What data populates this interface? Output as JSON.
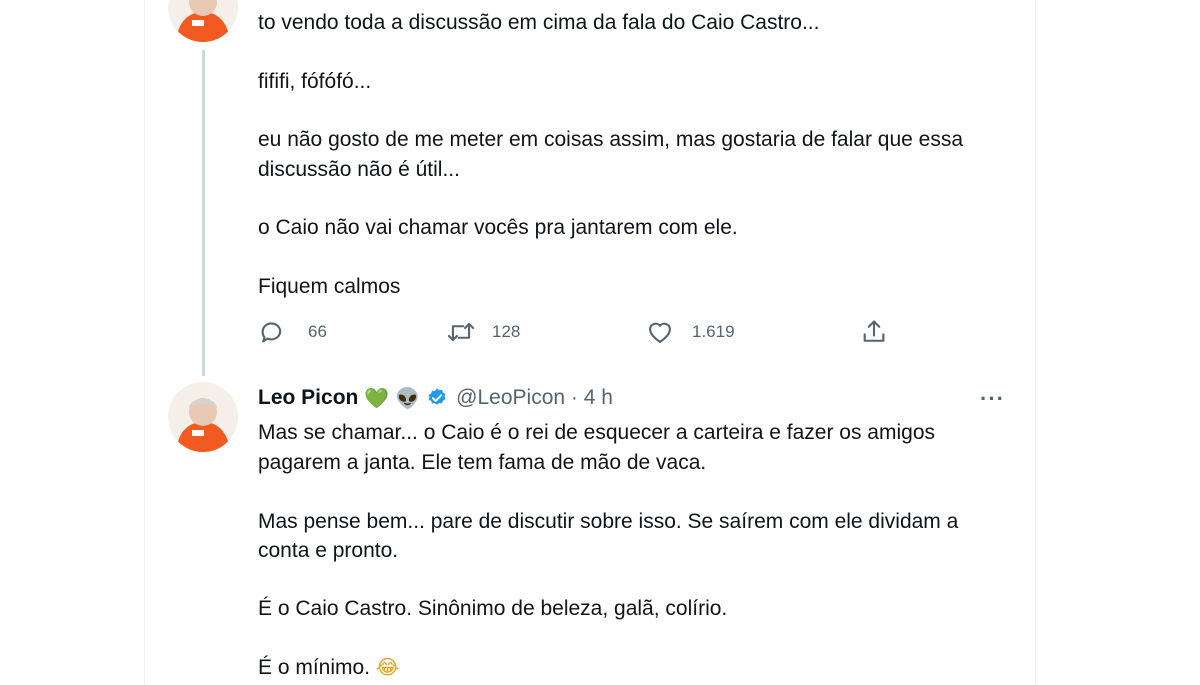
{
  "tweet1": {
    "paragraphs": [
      "to vendo toda a discussão em cima da fala do Caio Castro...",
      "fififi, fófófó...",
      "eu não gosto de me meter em coisas assim, mas gostaria de falar que essa",
      "discussão não é útil...",
      "o Caio não vai chamar vocês pra jantarem com ele.",
      "Fiquem calmos"
    ],
    "actions": {
      "reply_icon": "reply-icon",
      "reply_count": "66",
      "retweet_icon": "retweet-icon",
      "retweet_count": "128",
      "like_icon": "heart-icon",
      "like_count": "1.619",
      "share_icon": "share-icon"
    }
  },
  "tweet2": {
    "display_name": "Leo Picon",
    "name_emojis": [
      "💚",
      "👽"
    ],
    "verified_icon": "verified-badge-icon",
    "handle_time": "@LeoPicon · 4 h",
    "more_label": "···",
    "lines": [
      "Mas se chamar... o Caio é o rei de esquecer a carteira e fazer os amigos",
      "pagarem a janta. Ele tem fama de mão de vaca.",
      "Mas pense bem... pare de discutir sobre isso. Se saírem com ele dividam a",
      "conta e pronto.",
      "É o Caio Castro. Sinônimo de beleza, galã, colírio.",
      "É o mínimo."
    ],
    "last_emoji": "😂"
  },
  "colors": {
    "text": "#0f1419",
    "secondary": "#536471",
    "verified": "#1d9bf0",
    "avatar_orange": "#f25a22"
  }
}
